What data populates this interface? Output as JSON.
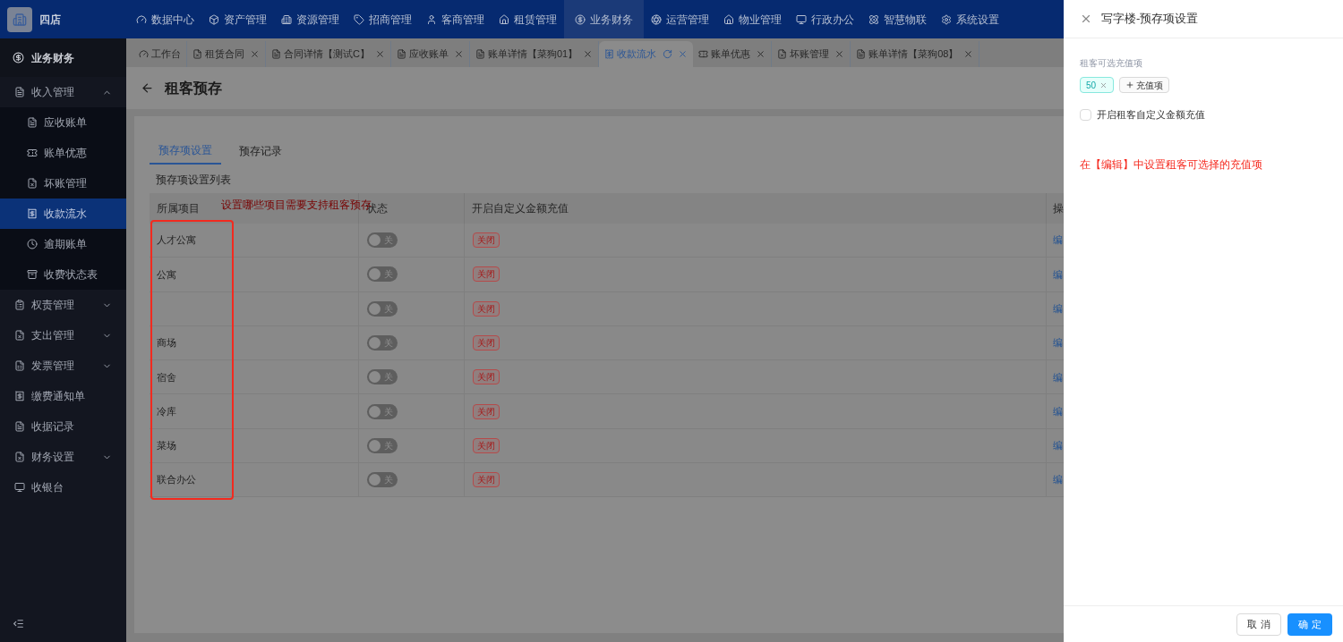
{
  "app": {
    "store_name": "四店"
  },
  "top_nav": [
    {
      "label": "数据中心",
      "selected": false
    },
    {
      "label": "资产管理",
      "selected": false
    },
    {
      "label": "资源管理",
      "selected": false
    },
    {
      "label": "招商管理",
      "selected": false
    },
    {
      "label": "客商管理",
      "selected": false
    },
    {
      "label": "租赁管理",
      "selected": false
    },
    {
      "label": "业务财务",
      "selected": true
    },
    {
      "label": "运营管理",
      "selected": false
    },
    {
      "label": "物业管理",
      "selected": false
    },
    {
      "label": "行政办公",
      "selected": false
    },
    {
      "label": "智慧物联",
      "selected": false
    },
    {
      "label": "系统设置",
      "selected": false
    }
  ],
  "sidebar": {
    "title": "业务财务",
    "items": [
      {
        "label": "收入管理",
        "kind": "group",
        "expanded": true,
        "children": [
          {
            "label": "应收账单",
            "selected": false
          },
          {
            "label": "账单优惠",
            "selected": false
          },
          {
            "label": "坏账管理",
            "selected": false
          },
          {
            "label": "收款流水",
            "selected": true
          },
          {
            "label": "逾期账单",
            "selected": false
          },
          {
            "label": "收费状态表",
            "selected": false
          }
        ]
      },
      {
        "label": "权责管理",
        "kind": "group",
        "expanded": false
      },
      {
        "label": "支出管理",
        "kind": "group",
        "expanded": false
      },
      {
        "label": "发票管理",
        "kind": "group",
        "expanded": false
      },
      {
        "label": "缴费通知单",
        "kind": "link"
      },
      {
        "label": "收据记录",
        "kind": "link"
      },
      {
        "label": "财务设置",
        "kind": "group",
        "expanded": false
      },
      {
        "label": "收银台",
        "kind": "link"
      }
    ]
  },
  "tabs": [
    {
      "label": "工作台",
      "closable": false,
      "selected": false
    },
    {
      "label": "租赁合同",
      "closable": true,
      "selected": false
    },
    {
      "label": "合同详情【测试C】",
      "closable": true,
      "selected": false
    },
    {
      "label": "应收账单",
      "closable": true,
      "selected": false
    },
    {
      "label": "账单详情【菜狗01】",
      "closable": true,
      "selected": false
    },
    {
      "label": "收款流水",
      "closable": true,
      "selected": true
    },
    {
      "label": "账单优惠",
      "closable": true,
      "selected": false
    },
    {
      "label": "坏账管理",
      "closable": true,
      "selected": false
    },
    {
      "label": "账单详情【菜狗08】",
      "closable": true,
      "selected": false
    }
  ],
  "page": {
    "title": "租客预存",
    "inner_tabs": [
      {
        "label": "预存项设置",
        "selected": true
      },
      {
        "label": "预存记录",
        "selected": false
      }
    ],
    "list_title": "预存项设置列表",
    "table": {
      "columns": [
        "所属项目",
        "状态",
        "开启自定义金额充值",
        "操"
      ],
      "rows": [
        {
          "project": "人才公寓",
          "on": false,
          "switch_text": "关",
          "custom_amount": "关闭",
          "action": "编"
        },
        {
          "project": "公寓",
          "on": false,
          "switch_text": "关",
          "custom_amount": "关闭",
          "action": "编"
        },
        {
          "on": false,
          "switch_text": "关",
          "custom_amount": "关闭",
          "action": "编"
        },
        {
          "project": "商场",
          "on": false,
          "switch_text": "关",
          "custom_amount": "关闭",
          "action": "编"
        },
        {
          "project": "宿舍",
          "on": false,
          "switch_text": "关",
          "custom_amount": "关闭",
          "action": "编"
        },
        {
          "project": "冷库",
          "on": false,
          "switch_text": "关",
          "custom_amount": "关闭",
          "action": "编"
        },
        {
          "project": "菜场",
          "on": false,
          "switch_text": "关",
          "custom_amount": "关闭",
          "action": "编"
        },
        {
          "project": "联合办公",
          "on": false,
          "switch_text": "关",
          "custom_amount": "关闭",
          "action": "编"
        }
      ]
    },
    "annotation": "设置哪些项目需要支持租客预存"
  },
  "drawer": {
    "title": "写字楼-预存项设置",
    "field_label": "租客可选充值项",
    "options": [
      "50"
    ],
    "add_button": "充值项",
    "custom_amount": {
      "label": "开启租客自定义金额充值",
      "checked": false
    },
    "annotation": "在【编辑】中设置租客可选择的充值项",
    "buttons": [
      {
        "label": "取 消",
        "kind": "secondary"
      },
      {
        "label": "确 定",
        "kind": "primary"
      }
    ]
  }
}
